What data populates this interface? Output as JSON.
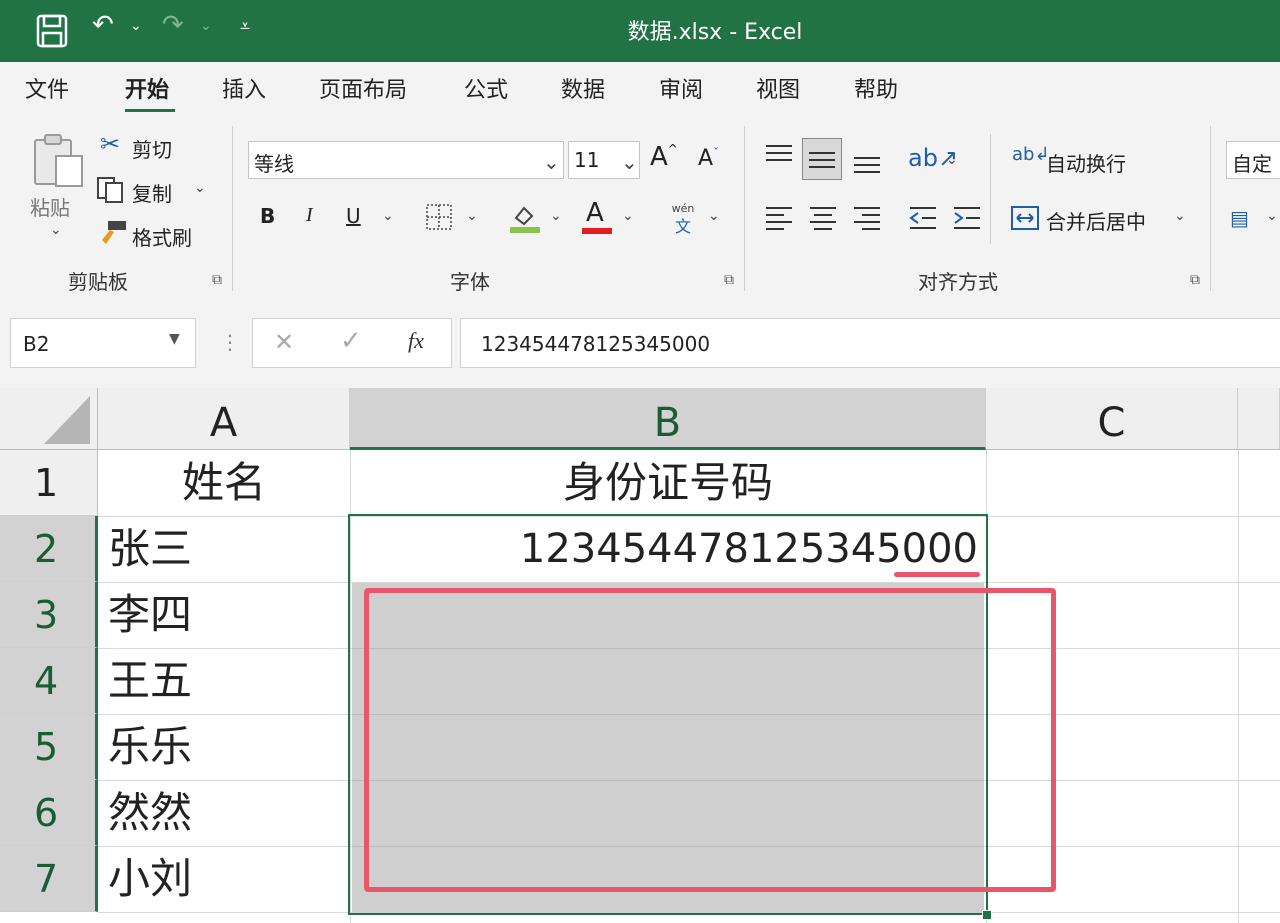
{
  "window": {
    "title": "数据.xlsx  -  Excel"
  },
  "quick_access": {
    "save_icon": "save-icon",
    "undo_icon": "undo-icon",
    "redo_icon": "redo-icon",
    "customize_icon": "customize-icon"
  },
  "menu": {
    "tabs": [
      "文件",
      "开始",
      "插入",
      "页面布局",
      "公式",
      "数据",
      "审阅",
      "视图",
      "帮助"
    ],
    "active": "开始"
  },
  "ribbon": {
    "clipboard": {
      "paste": "粘贴",
      "cut": "剪切",
      "copy": "复制",
      "format_painter": "格式刷",
      "label": "剪贴板"
    },
    "font": {
      "name": "等线",
      "size": "11",
      "grow": "A",
      "shrink": "A",
      "bold": "B",
      "italic": "I",
      "underline": "U",
      "font_color_letter": "A",
      "phonetic_top": "wén",
      "phonetic_bottom": "文",
      "label": "字体"
    },
    "alignment": {
      "wrap_text": "自动换行",
      "merge_center": "合并后居中",
      "label": "对齐方式"
    },
    "number": {
      "format": "自定"
    }
  },
  "formula_bar": {
    "name_box": "B2",
    "cancel": "✕",
    "enter": "✓",
    "fx": "fx",
    "content": "123454478125345000"
  },
  "columns": [
    "A",
    "B",
    "C"
  ],
  "rows": [
    {
      "num": "1",
      "a": "姓名",
      "b": "身份证号码"
    },
    {
      "num": "2",
      "a": "张三",
      "b": "123454478125345000"
    },
    {
      "num": "3",
      "a": "李四",
      "b": ""
    },
    {
      "num": "4",
      "a": "王五",
      "b": ""
    },
    {
      "num": "5",
      "a": "乐乐",
      "b": ""
    },
    {
      "num": "6",
      "a": "然然",
      "b": ""
    },
    {
      "num": "7",
      "a": "小刘",
      "b": ""
    }
  ],
  "colors": {
    "excel_green": "#217346",
    "highlight_red": "#e8566a",
    "selection_gray": "#cfcfcf"
  }
}
